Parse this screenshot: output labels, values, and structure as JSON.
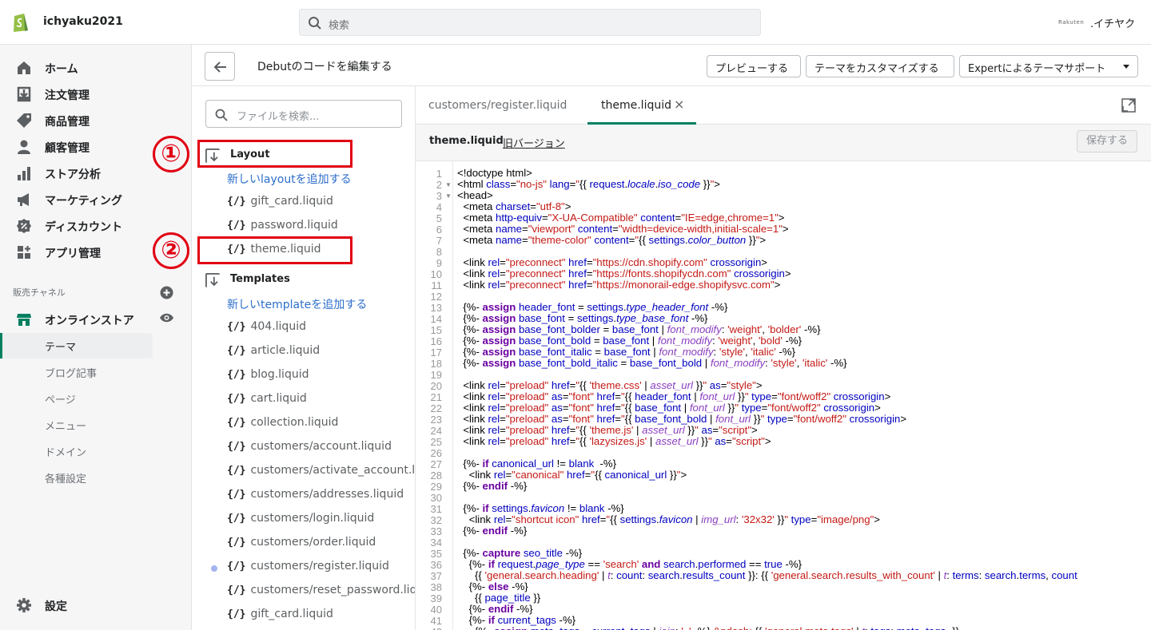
{
  "topbar": {
    "store_name": "ichyaku2021",
    "search_placeholder": "検索",
    "account_logo_text": "Rakuten",
    "account_name": ".イチヤク"
  },
  "sidebar": {
    "items": [
      {
        "label": "ホーム",
        "icon": "home-icon"
      },
      {
        "label": "注文管理",
        "icon": "orders-icon"
      },
      {
        "label": "商品管理",
        "icon": "tag-icon"
      },
      {
        "label": "顧客管理",
        "icon": "customer-icon"
      },
      {
        "label": "ストア分析",
        "icon": "analytics-icon"
      },
      {
        "label": "マーケティング",
        "icon": "megaphone-icon"
      },
      {
        "label": "ディスカウント",
        "icon": "discount-icon"
      },
      {
        "label": "アプリ管理",
        "icon": "apps-icon"
      }
    ],
    "channels_label": "販売チャネル",
    "online_store": "オンラインストア",
    "sub_items": [
      "テーマ",
      "ブログ記事",
      "ページ",
      "メニュー",
      "ドメイン",
      "各種設定"
    ],
    "settings": "設定"
  },
  "header": {
    "title": "Debutのコードを編集する",
    "preview": "プレビューする",
    "customize": "テーマをカスタマイズする",
    "expert": "Expertによるテーマサポート"
  },
  "files": {
    "search_placeholder": "ファイルを検索...",
    "layout_folder": "Layout",
    "add_layout": "新しいlayoutを追加する",
    "layout_files": [
      "gift_card.liquid",
      "password.liquid",
      "theme.liquid"
    ],
    "templates_folder": "Templates",
    "add_template": "新しいtemplateを追加する",
    "template_files": [
      "404.liquid",
      "article.liquid",
      "blog.liquid",
      "cart.liquid",
      "collection.liquid",
      "customers/account.liquid",
      "customers/activate_account.liquid",
      "customers/addresses.liquid",
      "customers/login.liquid",
      "customers/order.liquid",
      "customers/register.liquid",
      "customers/reset_password.liquid",
      "gift_card.liquid"
    ],
    "bracket": "{/}",
    "marker1": "①",
    "marker2": "②"
  },
  "editor": {
    "tab1": "customers/register.liquid",
    "tab2": "theme.liquid",
    "tab_close": "×",
    "file_name": "theme.liquid",
    "old_version": "旧バージョン",
    "save": "保存する"
  },
  "colors": {
    "accent": "#008060",
    "annotation_red": "#e10012",
    "link": "#2c6ecb"
  }
}
